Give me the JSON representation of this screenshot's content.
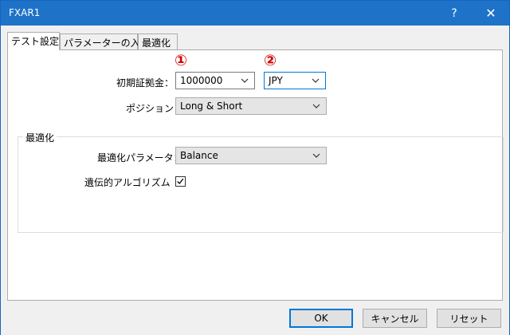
{
  "window": {
    "title": "FXAR1",
    "help_label": "?",
    "close_label": "✕"
  },
  "tabs": [
    {
      "label": "テスト設定",
      "active": true
    },
    {
      "label": "パラメーターの入力",
      "active": false
    },
    {
      "label": "最適化",
      "active": false
    }
  ],
  "test_settings": {
    "initial_deposit": {
      "label": "初期証拠金：",
      "value": "1000000"
    },
    "currency": {
      "value": "JPY"
    },
    "position": {
      "label": "ポジション：",
      "value": "Long & Short"
    },
    "markers": [
      "①",
      "②"
    ]
  },
  "optimization_group": {
    "title": "最適化",
    "parameter": {
      "label": "最適化パラメータ：",
      "value": "Balance"
    },
    "genetic_algorithm": {
      "label": "遺伝的アルゴリズム",
      "checked": true
    }
  },
  "buttons": {
    "ok": "OK",
    "cancel": "キャンセル",
    "reset": "リセット"
  }
}
